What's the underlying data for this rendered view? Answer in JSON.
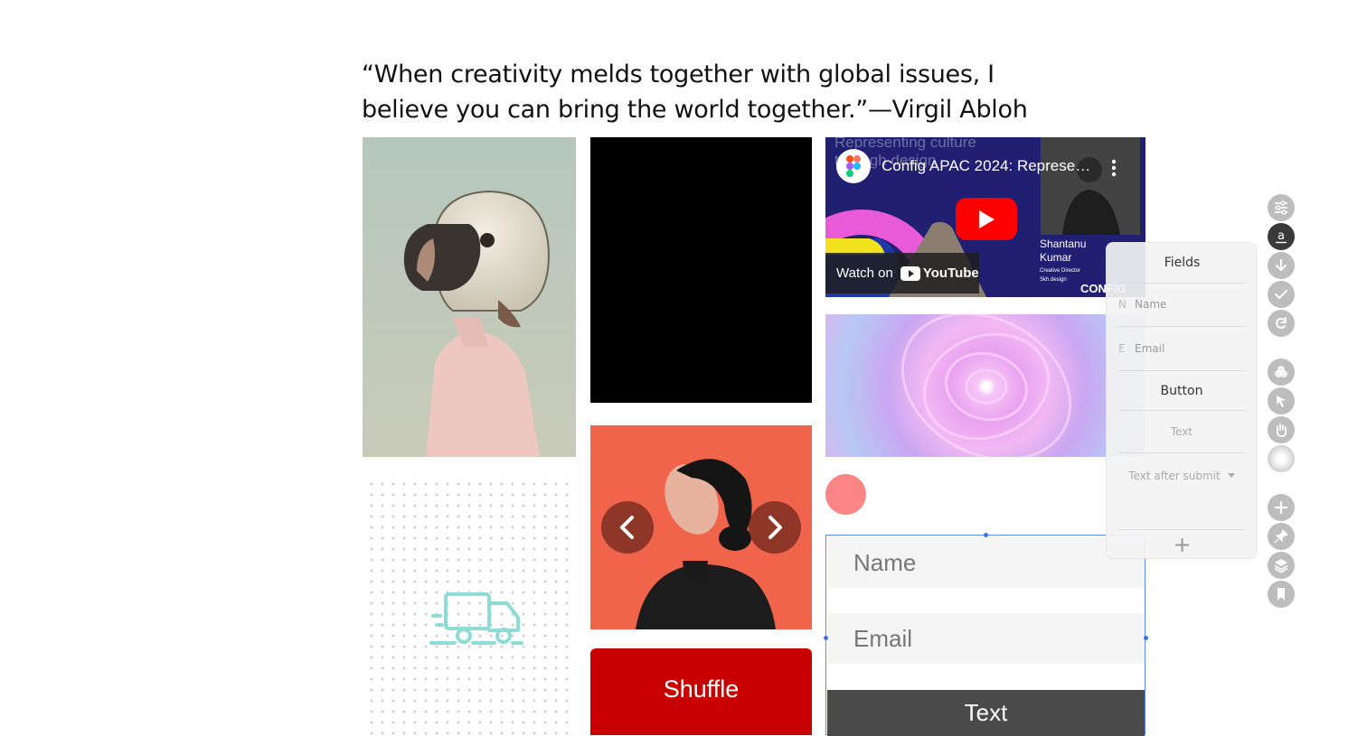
{
  "quote": {
    "line1": "“When creativity melds together with global issues, I",
    "line2": "believe you can bring the world together.”—Virgil Abloh"
  },
  "youtube": {
    "title": "Config APAC 2024: Represe…",
    "bg_text_line1": "Representing culture",
    "bg_text_line2": "through design",
    "speaker_name_1": "Shantanu",
    "speaker_name_2": "Kumar",
    "speaker_role_1": "Creative Director",
    "speaker_role_2": "Skh.design",
    "watch_on": "Watch on",
    "yt_logo_text": "YouTube",
    "corner_logo": "CONFIG"
  },
  "shuffle": {
    "label": "Shuffle"
  },
  "form": {
    "name_placeholder": "Name",
    "email_placeholder": "Email",
    "submit_label": "Text"
  },
  "fields_panel": {
    "title": "Fields",
    "fields": [
      {
        "letter": "N",
        "label": "Name"
      },
      {
        "letter": "E",
        "label": "Email"
      }
    ],
    "button_label": "Button",
    "text_label": "Text",
    "after_submit_label": "Text after submit",
    "add_symbol": "+"
  },
  "toolbar": {
    "items": [
      "sliders-icon",
      "text-a-icon",
      "download-icon",
      "check-icon",
      "redo-icon",
      "shapes-icon",
      "cursor-icon",
      "hand-icon",
      "gradient-icon",
      "plus-icon",
      "pin-icon",
      "layers-icon",
      "bookmark-icon"
    ]
  },
  "colors": {
    "shuffle_bg": "#c80000",
    "carousel_bg": "#f0634a",
    "red_dot": "#fb8585",
    "youtube_red": "#ff0000",
    "form_selection": "#5a8bef",
    "submit_bg": "#4a4a4a"
  }
}
